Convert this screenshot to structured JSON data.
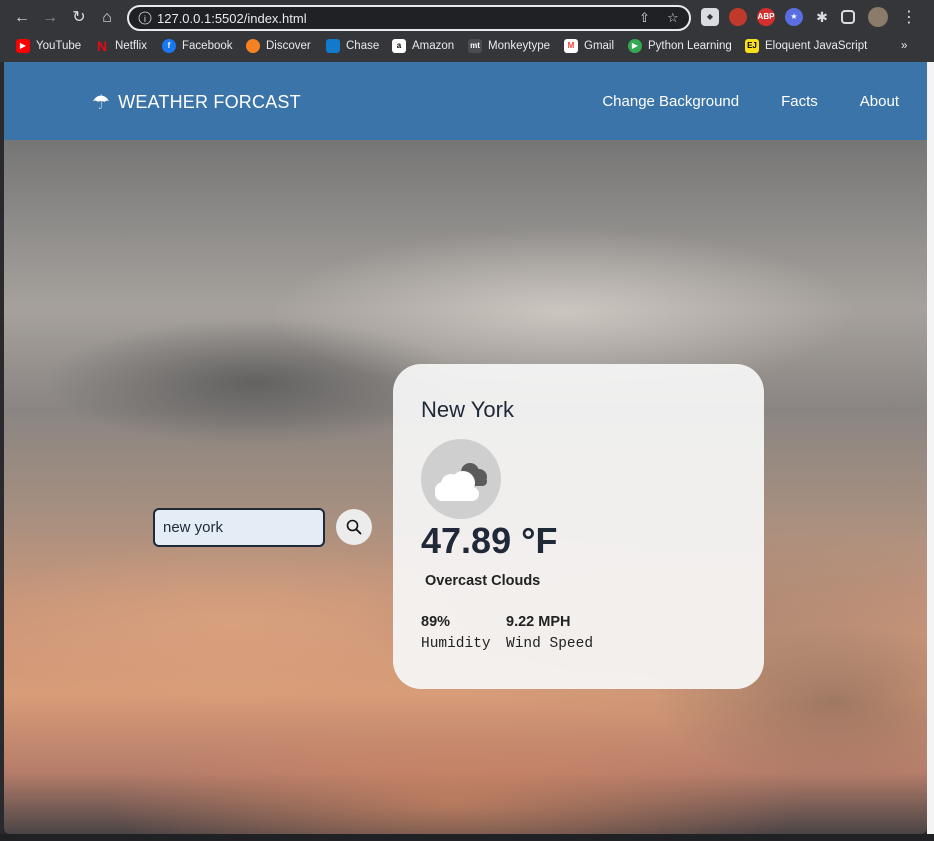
{
  "browser": {
    "url": "127.0.0.1:5502/index.html",
    "bookmarks": [
      {
        "label": "YouTube",
        "color": "#ff0000"
      },
      {
        "label": "Netflix",
        "color": "#e50914"
      },
      {
        "label": "Facebook",
        "color": "#1877f2"
      },
      {
        "label": "Discover",
        "color": "#f58220"
      },
      {
        "label": "Chase",
        "color": "#117aca"
      },
      {
        "label": "Amazon",
        "color": "#ffffff"
      },
      {
        "label": "Monkeytype",
        "color": "#323437"
      },
      {
        "label": "Gmail",
        "color": "#ea4335"
      },
      {
        "label": "Python Learning",
        "color": "#34a853"
      },
      {
        "label": "Eloquent JavaScript",
        "color": "#f7df1e"
      }
    ],
    "more_label": "»"
  },
  "header": {
    "logo_text": "WEATHER FORCAST",
    "nav": [
      "Change Background",
      "Facts",
      "About"
    ]
  },
  "search": {
    "value": "new york"
  },
  "weather": {
    "city": "New York",
    "temperature": "47.89 °F",
    "description": "Overcast Clouds",
    "humidity_value": "89%",
    "humidity_label": "Humidity",
    "wind_value": "9.22 MPH",
    "wind_label": "Wind Speed"
  }
}
